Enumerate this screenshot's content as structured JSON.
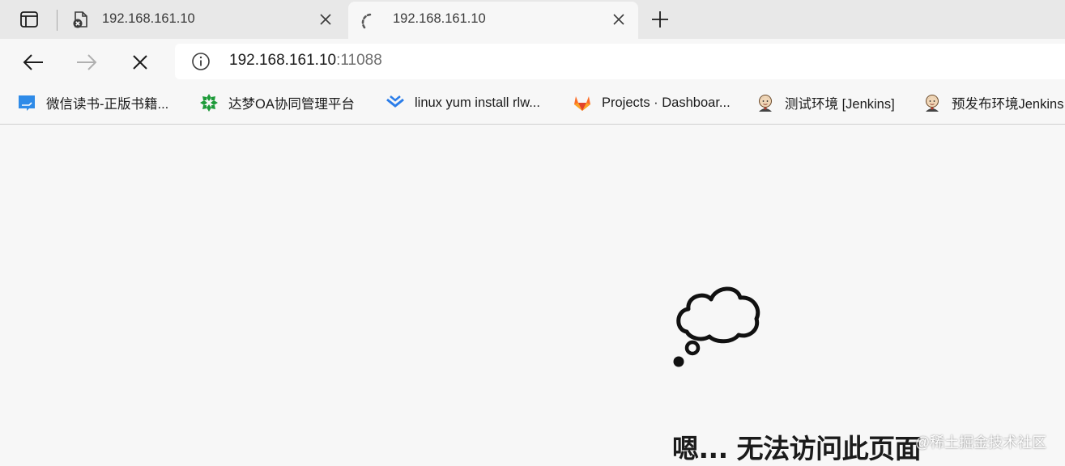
{
  "tabs": [
    {
      "title": "192.168.161.10",
      "state": "inactive",
      "favicon": "page-error-icon"
    },
    {
      "title": "192.168.161.10",
      "state": "loading",
      "favicon": "loading-spinner-icon"
    }
  ],
  "toolbar": {
    "back_icon": "back-arrow-icon",
    "forward_icon": "forward-arrow-icon",
    "stop_icon": "stop-icon"
  },
  "address_bar": {
    "host": "192.168.161.10",
    "port": ":11088"
  },
  "bookmarks": [
    {
      "label": "微信读书-正版书籍...",
      "icon": "weread-icon"
    },
    {
      "label": "达梦OA协同管理平台",
      "icon": "dameng-oa-icon"
    },
    {
      "label": "linux yum install rlw...",
      "icon": "blue-chevrons-icon"
    },
    {
      "label": "Projects · Dashboar...",
      "icon": "gitlab-icon"
    },
    {
      "label": "测试环境 [Jenkins]",
      "icon": "jenkins-icon"
    },
    {
      "label": "预发布环境Jenkins",
      "icon": "jenkins-icon"
    }
  ],
  "error": {
    "title": "嗯... 无法访问此页面",
    "icon": "thought-cloud-icon"
  },
  "watermark": "@稀土掘金技术社区",
  "colors": {
    "tabstrip_bg": "#e8e8e8",
    "page_bg": "#f7f7f7",
    "omnibox_bg": "#ffffff",
    "port_text": "#6f6f6f",
    "loading_accent": "#0078d4"
  }
}
